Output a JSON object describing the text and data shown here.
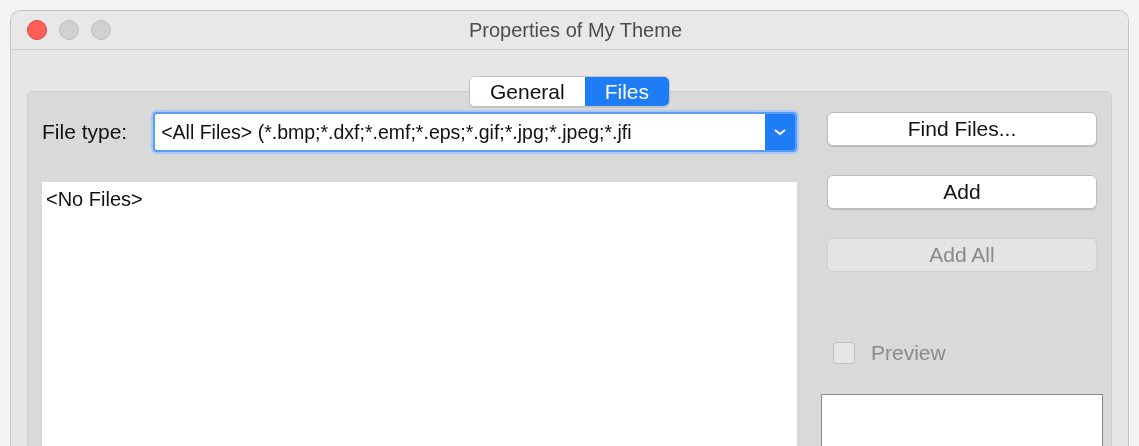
{
  "window": {
    "title": "Properties of My Theme"
  },
  "tabs": [
    {
      "label": "General",
      "selected": false
    },
    {
      "label": "Files",
      "selected": true
    }
  ],
  "file_type": {
    "label": "File type:",
    "value": "<All Files> (*.bmp;*.dxf;*.emf;*.eps;*.gif;*.jpg;*.jpeg;*.jfi",
    "focused": true
  },
  "file_list": {
    "items": [
      "<No Files>"
    ]
  },
  "buttons": [
    {
      "label": "Find Files...",
      "disabled": false
    },
    {
      "label": "Add",
      "disabled": false
    },
    {
      "label": "Add All",
      "disabled": true
    }
  ],
  "preview": {
    "label": "Preview",
    "checked": false,
    "disabled": true
  }
}
